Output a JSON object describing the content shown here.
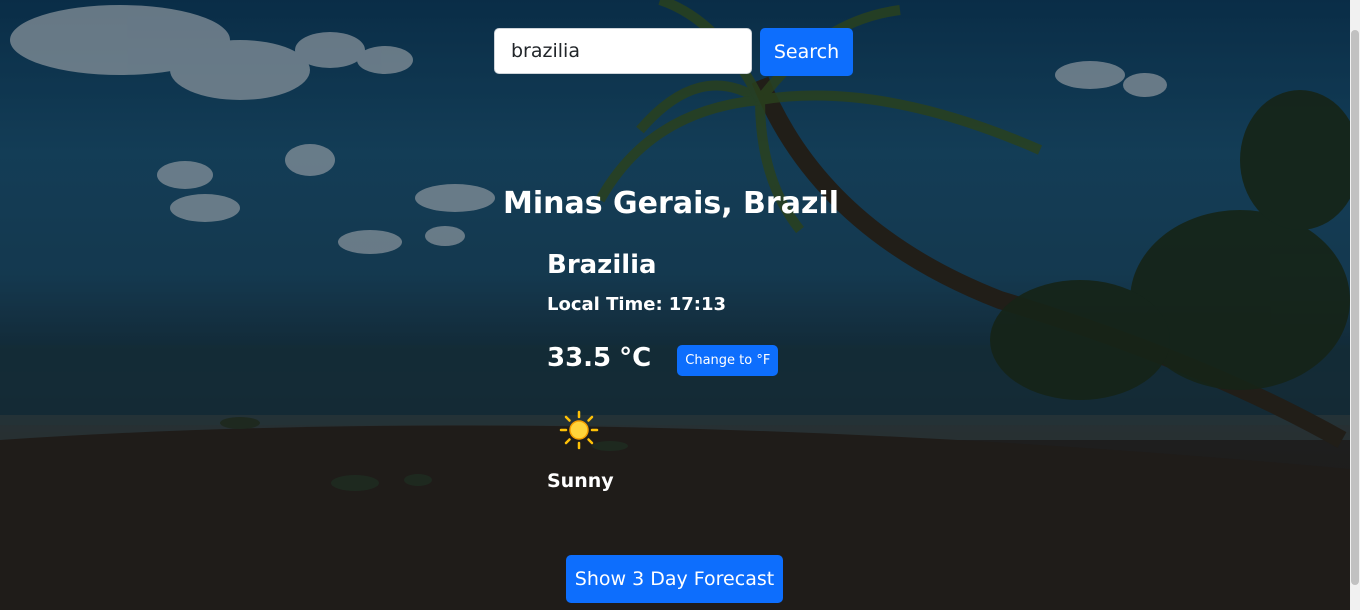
{
  "search": {
    "value": "brazilia",
    "button_label": "Search"
  },
  "location": {
    "region_country": "Minas Gerais, Brazil",
    "city": "Brazilia",
    "local_time_label": "Local Time:",
    "local_time": "17:13"
  },
  "current": {
    "temperature": "33.5",
    "unit": "°C",
    "toggle_label": "Change to °F",
    "condition": "Sunny",
    "condition_icon": "sun-icon"
  },
  "forecast_button_label": "Show 3 Day Forecast",
  "colors": {
    "accent": "#0d6efd",
    "text": "#ffffff",
    "sun": "#ffc107"
  }
}
